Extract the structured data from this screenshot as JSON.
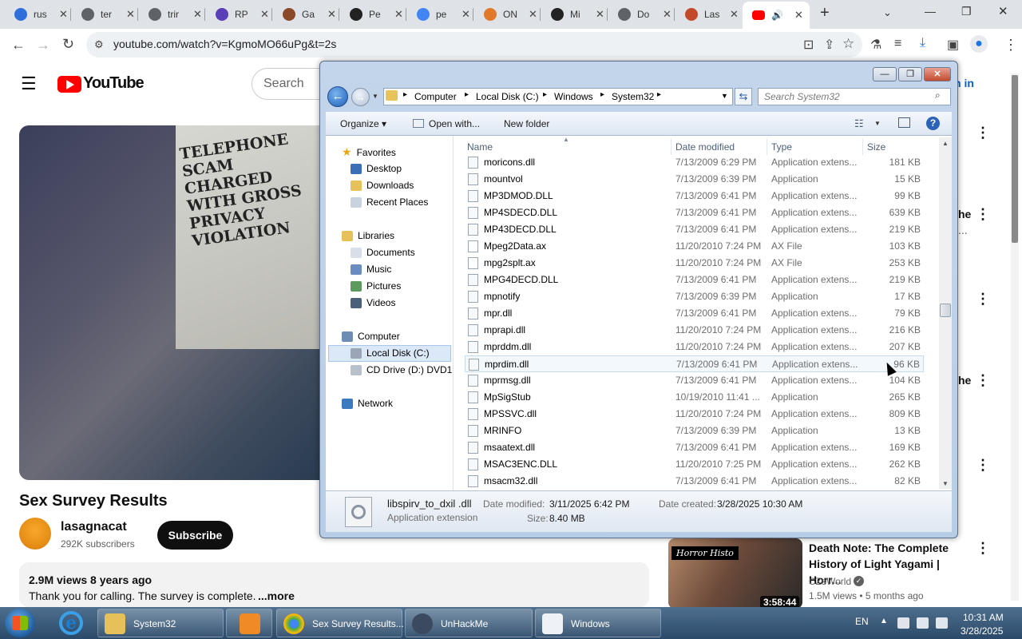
{
  "chrome": {
    "tabs": [
      {
        "label": "rus",
        "color": "#2f6fdc"
      },
      {
        "label": "ter",
        "color": "#5f6368"
      },
      {
        "label": "trir",
        "color": "#5f6368"
      },
      {
        "label": "RP",
        "color": "#5b3fb8"
      },
      {
        "label": "Ga",
        "color": "#8a4a2a"
      },
      {
        "label": "Pe",
        "color": "#222222"
      },
      {
        "label": "pe",
        "color": "#4285f4"
      },
      {
        "label": "ON",
        "color": "#e07a2a"
      },
      {
        "label": "Mi",
        "color": "#222222"
      },
      {
        "label": "Do",
        "color": "#5f6368"
      },
      {
        "label": "Las",
        "color": "#c24a2a"
      }
    ],
    "active_tab_close": "✕",
    "new_tab": "+",
    "url": "youtube.com/watch?v=KgmoMO66uPg&t=2s"
  },
  "youtube": {
    "logo": "YouTube",
    "search_placeholder": "Search",
    "signin": "n in",
    "paper_headline": "TELEPHONE SCAM CHARGED WITH GROSS PRIVACY VIOLATION",
    "video_title": "Sex Survey Results",
    "channel_name": "lasagnacat",
    "subscribers": "292K subscribers",
    "subscribe_label": "Subscribe",
    "views": "2.9M views  8 years ago",
    "description": "Thank you for calling. The survey is complete. ",
    "more": "...more",
    "edge_texts": [
      "he",
      "...",
      "he",
      "he"
    ],
    "rec": {
      "badge": "Horror Histo",
      "duration": "3:58:44",
      "title": "Death Note: The Complete History of Light Yagami | Horr...",
      "channel": "CZsWorld",
      "check": "✓",
      "meta": "1.5M views • 5 months ago"
    }
  },
  "explorer": {
    "caption_buttons": {
      "minimize": "—",
      "maximize": "❐",
      "close": "✕"
    },
    "breadcrumb": [
      "Computer",
      "Local Disk (C:)",
      "Windows",
      "System32"
    ],
    "search_placeholder": "Search System32",
    "commands": {
      "organize": "Organize ▾",
      "open_with": "Open with...",
      "new_folder": "New folder"
    },
    "nav": {
      "favorites_header": "Favorites",
      "favorites": [
        "Desktop",
        "Downloads",
        "Recent Places"
      ],
      "libraries_header": "Libraries",
      "libraries": [
        "Documents",
        "Music",
        "Pictures",
        "Videos"
      ],
      "computer_header": "Computer",
      "computer": [
        "Local Disk (C:)",
        "CD Drive (D:) DVD1"
      ],
      "network": "Network"
    },
    "columns": {
      "name": "Name",
      "date": "Date modified",
      "type": "Type",
      "size": "Size"
    },
    "files": [
      {
        "name": "moricons.dll",
        "date": "7/13/2009 6:29 PM",
        "type": "Application extens...",
        "size": "181 KB"
      },
      {
        "name": "mountvol",
        "date": "7/13/2009 6:39 PM",
        "type": "Application",
        "size": "15 KB"
      },
      {
        "name": "MP3DMOD.DLL",
        "date": "7/13/2009 6:41 PM",
        "type": "Application extens...",
        "size": "99 KB"
      },
      {
        "name": "MP4SDECD.DLL",
        "date": "7/13/2009 6:41 PM",
        "type": "Application extens...",
        "size": "639 KB"
      },
      {
        "name": "MP43DECD.DLL",
        "date": "7/13/2009 6:41 PM",
        "type": "Application extens...",
        "size": "219 KB"
      },
      {
        "name": "Mpeg2Data.ax",
        "date": "11/20/2010 7:24 PM",
        "type": "AX File",
        "size": "103 KB"
      },
      {
        "name": "mpg2splt.ax",
        "date": "11/20/2010 7:24 PM",
        "type": "AX File",
        "size": "253 KB"
      },
      {
        "name": "MPG4DECD.DLL",
        "date": "7/13/2009 6:41 PM",
        "type": "Application extens...",
        "size": "219 KB"
      },
      {
        "name": "mpnotify",
        "date": "7/13/2009 6:39 PM",
        "type": "Application",
        "size": "17 KB"
      },
      {
        "name": "mpr.dll",
        "date": "7/13/2009 6:41 PM",
        "type": "Application extens...",
        "size": "79 KB"
      },
      {
        "name": "mprapi.dll",
        "date": "11/20/2010 7:24 PM",
        "type": "Application extens...",
        "size": "216 KB"
      },
      {
        "name": "mprddm.dll",
        "date": "11/20/2010 7:24 PM",
        "type": "Application extens...",
        "size": "207 KB"
      },
      {
        "name": "mprdim.dll",
        "date": "7/13/2009 6:41 PM",
        "type": "Application extens...",
        "size": "96 KB"
      },
      {
        "name": "mprmsg.dll",
        "date": "7/13/2009 6:41 PM",
        "type": "Application extens...",
        "size": "104 KB"
      },
      {
        "name": "MpSigStub",
        "date": "10/19/2010 11:41 ...",
        "type": "Application",
        "size": "265 KB"
      },
      {
        "name": "MPSSVC.dll",
        "date": "11/20/2010 7:24 PM",
        "type": "Application extens...",
        "size": "809 KB"
      },
      {
        "name": "MRINFO",
        "date": "7/13/2009 6:39 PM",
        "type": "Application",
        "size": "13 KB"
      },
      {
        "name": "msaatext.dll",
        "date": "7/13/2009 6:41 PM",
        "type": "Application extens...",
        "size": "169 KB"
      },
      {
        "name": "MSAC3ENC.DLL",
        "date": "11/20/2010 7:25 PM",
        "type": "Application extens...",
        "size": "262 KB"
      },
      {
        "name": "msacm32.dll",
        "date": "7/13/2009 6:41 PM",
        "type": "Application extens...",
        "size": "82 KB"
      }
    ],
    "details": {
      "filename": "libspirv_to_dxil .dll",
      "filetype": "Application extension",
      "date_modified_label": "Date modified:",
      "date_modified": "3/11/2025 6:42 PM",
      "size_label": "Size:",
      "size": "8.40 MB",
      "date_created_label": "Date created:",
      "date_created": "3/28/2025 10:30 AM"
    }
  },
  "taskbar": {
    "items": [
      "System32",
      "Sex Survey Results...",
      "UnHackMe",
      "Windows"
    ],
    "language": "EN",
    "time": "10:31 AM",
    "date": "3/28/2025"
  }
}
